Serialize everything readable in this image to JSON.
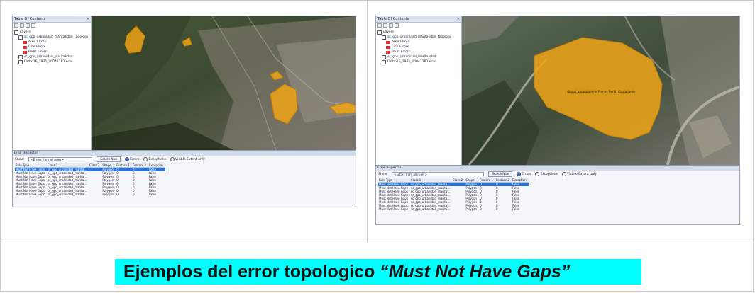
{
  "caption": {
    "prefix": "Ejemplos del error topologico ",
    "quoted": "“Must Not Have Gaps”",
    "highlight_color": "#00ffff"
  },
  "colors": {
    "polygon_fill": "#f0a418",
    "polygon_stroke": "#c88100",
    "selected_row": "#2f74d0",
    "panel_title": "#d3dcea"
  },
  "left_panel": {
    "toc_title": "Table Of Contents",
    "toc_items": [
      {
        "label": "Layers",
        "level": 0
      },
      {
        "label": "sc_gpo_urbanidad_maritalidad_topology",
        "level": 1
      },
      {
        "label": "Area Errors",
        "level": 2
      },
      {
        "label": "Line Errors",
        "level": 2
      },
      {
        "label": "Point Errors",
        "level": 2
      },
      {
        "label": "sc_gpo_urbanidad_maritalidad",
        "level": 1
      },
      {
        "label": "Ortho16_2935_20041182.ecw",
        "level": 1
      }
    ],
    "error_panel": {
      "title": "Error Inspector",
      "show_label": "Show:",
      "show_value": "<Errors from all rules>",
      "search_button": "Search Now",
      "options": [
        "Errors",
        "Exceptions",
        "Visible Extent only"
      ],
      "columns": [
        "Rule Type",
        "Class 1",
        "Class 2",
        "Shape",
        "Feature 1",
        "Feature 2",
        "Exception"
      ],
      "rows": [
        [
          "Must Not Have Gaps",
          "sc_gpo_urbanidad_marita...",
          "",
          "Polygon",
          "0",
          "0",
          "False"
        ],
        [
          "Must Not Have Gaps",
          "sc_gpo_urbanidad_marita...",
          "",
          "Polygon",
          "0",
          "0",
          "False"
        ],
        [
          "Must Not Have Gaps",
          "sc_gpo_urbanidad_marita...",
          "",
          "Polygon",
          "0",
          "0",
          "False"
        ],
        [
          "Must Not Have Gaps",
          "sc_gpo_urbanidad_marita...",
          "",
          "Polygon",
          "0",
          "0",
          "False"
        ],
        [
          "Must Not Have Gaps",
          "sc_gpo_urbanidad_marita...",
          "",
          "Polygon",
          "0",
          "0",
          "False"
        ],
        [
          "Must Not Have Gaps",
          "sc_gpo_urbanidad_marita...",
          "",
          "Polygon",
          "0",
          "0",
          "False"
        ],
        [
          "Must Not Have Gaps",
          "sc_gpo_urbanidad_marita...",
          "",
          "Polygon",
          "0",
          "0",
          "False"
        ],
        [
          "Must Not Have Gaps",
          "sc_gpo_urbanidad_marita...",
          "",
          "Polygon",
          "0",
          "0",
          "False"
        ]
      ]
    }
  },
  "right_panel": {
    "toc_title": "Table Of Contents",
    "toc_items": [
      {
        "label": "Layers",
        "level": 0
      },
      {
        "label": "sc_gpo_urbanidad_maritalidad_topology",
        "level": 1
      },
      {
        "label": "Area Errors",
        "level": 2
      },
      {
        "label": "Line Errors",
        "level": 2
      },
      {
        "label": "Point Errors",
        "level": 2
      },
      {
        "label": "sc_gpo_urbanidad_maritalidad",
        "level": 1
      },
      {
        "label": "Ortho16_2935_20041182.ecw",
        "level": 1
      }
    ],
    "map_label": "Global urbanidad de Planes Perfil: Ciudadania",
    "error_panel": {
      "title": "Error Inspector",
      "show_label": "Show:",
      "show_value": "<Errors from all rules>",
      "search_button": "Search Now",
      "options": [
        "Errors",
        "Exceptions",
        "Visible Extent only"
      ],
      "columns": [
        "Rule Type",
        "Class 1",
        "Class 2",
        "Shape",
        "Feature 1",
        "Feature 2",
        "Exception"
      ],
      "rows": [
        [
          "Must Not Have Gaps",
          "sc_gpo_urbanidad_marita...",
          "",
          "Polygon",
          "0",
          "0",
          "False"
        ],
        [
          "Must Not Have Gaps",
          "sc_gpo_urbanidad_marita...",
          "",
          "Polygon",
          "0",
          "0",
          "False"
        ],
        [
          "Must Not Have Gaps",
          "sc_gpo_urbanidad_marita...",
          "",
          "Polygon",
          "0",
          "0",
          "False"
        ],
        [
          "Must Not Have Gaps",
          "sc_gpo_urbanidad_marita...",
          "",
          "Polygon",
          "0",
          "0",
          "False"
        ],
        [
          "Must Not Have Gaps",
          "sc_gpo_urbanidad_marita...",
          "",
          "Polygon",
          "0",
          "0",
          "False"
        ],
        [
          "Must Not Have Gaps",
          "sc_gpo_urbanidad_marita...",
          "",
          "Polygon",
          "0",
          "0",
          "False"
        ],
        [
          "Must Not Have Gaps",
          "sc_gpo_urbanidad_marita...",
          "",
          "Polygon",
          "0",
          "0",
          "False"
        ],
        [
          "Must Not Have Gaps",
          "sc_gpo_urbanidad_marita...",
          "",
          "Polygon",
          "0",
          "0",
          "False"
        ]
      ]
    }
  }
}
